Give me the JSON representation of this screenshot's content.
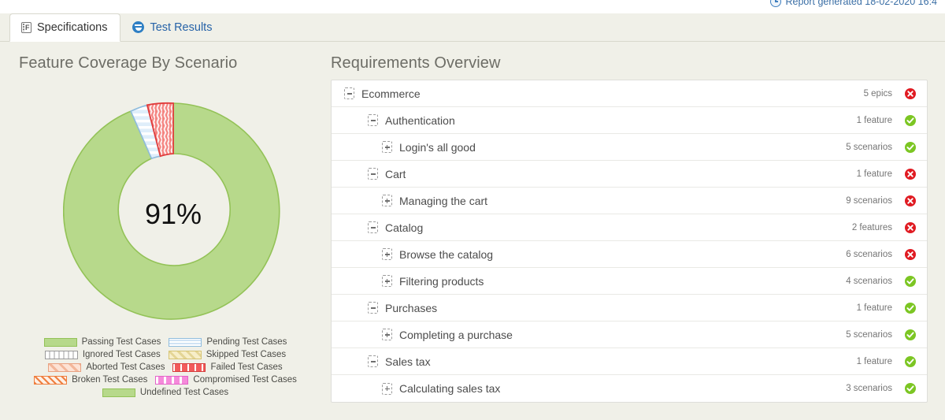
{
  "report": {
    "generated_label": "Report generated 18-02-2020 16:4",
    "icon": "clock-icon"
  },
  "tabs": [
    {
      "label": "Specifications",
      "icon": "specification-icon",
      "active": true
    },
    {
      "label": "Test Results",
      "icon": "smiley-face-icon",
      "active": false
    }
  ],
  "chart_panel": {
    "title": "Feature Coverage By Scenario",
    "center_label": "91%"
  },
  "list_panel": {
    "title": "Requirements Overview"
  },
  "legend": [
    {
      "label": "Passing Test Cases",
      "swatch": "sw-passing",
      "color": "#b7d98b"
    },
    {
      "label": "Pending Test Cases",
      "swatch": "sw-pending",
      "color": "#dcebf7"
    },
    {
      "label": "Ignored Test Cases",
      "swatch": "sw-ignored",
      "color": "#ededed"
    },
    {
      "label": "Skipped Test Cases",
      "swatch": "sw-skipped",
      "color": "#f2e7b8"
    },
    {
      "label": "Aborted Test Cases",
      "swatch": "sw-aborted",
      "color": "#fbd7c7"
    },
    {
      "label": "Failed Test Cases",
      "swatch": "sw-failed",
      "color": "#f25b5b"
    },
    {
      "label": "Broken Test Cases",
      "swatch": "sw-broken",
      "color": "#ef7f3f"
    },
    {
      "label": "Compromised Test Cases",
      "swatch": "sw-comprom",
      "color": "#f7a0e3"
    },
    {
      "label": "Undefined Test Cases",
      "swatch": "sw-undefined",
      "color": "#b7d98b"
    }
  ],
  "chart_data": {
    "type": "pie",
    "title": "Feature Coverage By Scenario",
    "center_label": "91%",
    "donut": true,
    "inner_radius_ratio": 0.49,
    "categories": [
      "Passing Test Cases",
      "Pending Test Cases",
      "Failed Test Cases"
    ],
    "values": [
      91,
      3.5,
      5.5
    ],
    "unit": "percent",
    "colors": [
      "#b7d98b",
      "#dcebf7",
      "#f25b5b"
    ],
    "legend_position": "bottom",
    "grid": false
  },
  "requirements": [
    {
      "name": "Ecommerce",
      "level": 0,
      "expander": "minus",
      "count": "5 epics",
      "status": "bad"
    },
    {
      "name": "Authentication",
      "level": 1,
      "expander": "minus",
      "count": "1 feature",
      "status": "ok"
    },
    {
      "name": "Login's all good",
      "level": 2,
      "expander": "plus",
      "count": "5 scenarios",
      "status": "ok"
    },
    {
      "name": "Cart",
      "level": 1,
      "expander": "minus",
      "count": "1 feature",
      "status": "bad"
    },
    {
      "name": "Managing the cart",
      "level": 2,
      "expander": "plus",
      "count": "9 scenarios",
      "status": "bad"
    },
    {
      "name": "Catalog",
      "level": 1,
      "expander": "minus",
      "count": "2 features",
      "status": "bad"
    },
    {
      "name": "Browse the catalog",
      "level": 2,
      "expander": "plus",
      "count": "6 scenarios",
      "status": "bad"
    },
    {
      "name": "Filtering products",
      "level": 2,
      "expander": "plus",
      "count": "4 scenarios",
      "status": "ok"
    },
    {
      "name": "Purchases",
      "level": 1,
      "expander": "minus",
      "count": "1 feature",
      "status": "ok"
    },
    {
      "name": "Completing a purchase",
      "level": 2,
      "expander": "plus",
      "count": "5 scenarios",
      "status": "ok"
    },
    {
      "name": "Sales tax",
      "level": 1,
      "expander": "minus",
      "count": "1 feature",
      "status": "ok"
    },
    {
      "name": "Calculating sales tax",
      "level": 2,
      "expander": "plus",
      "count": "3 scenarios",
      "status": "ok"
    }
  ]
}
